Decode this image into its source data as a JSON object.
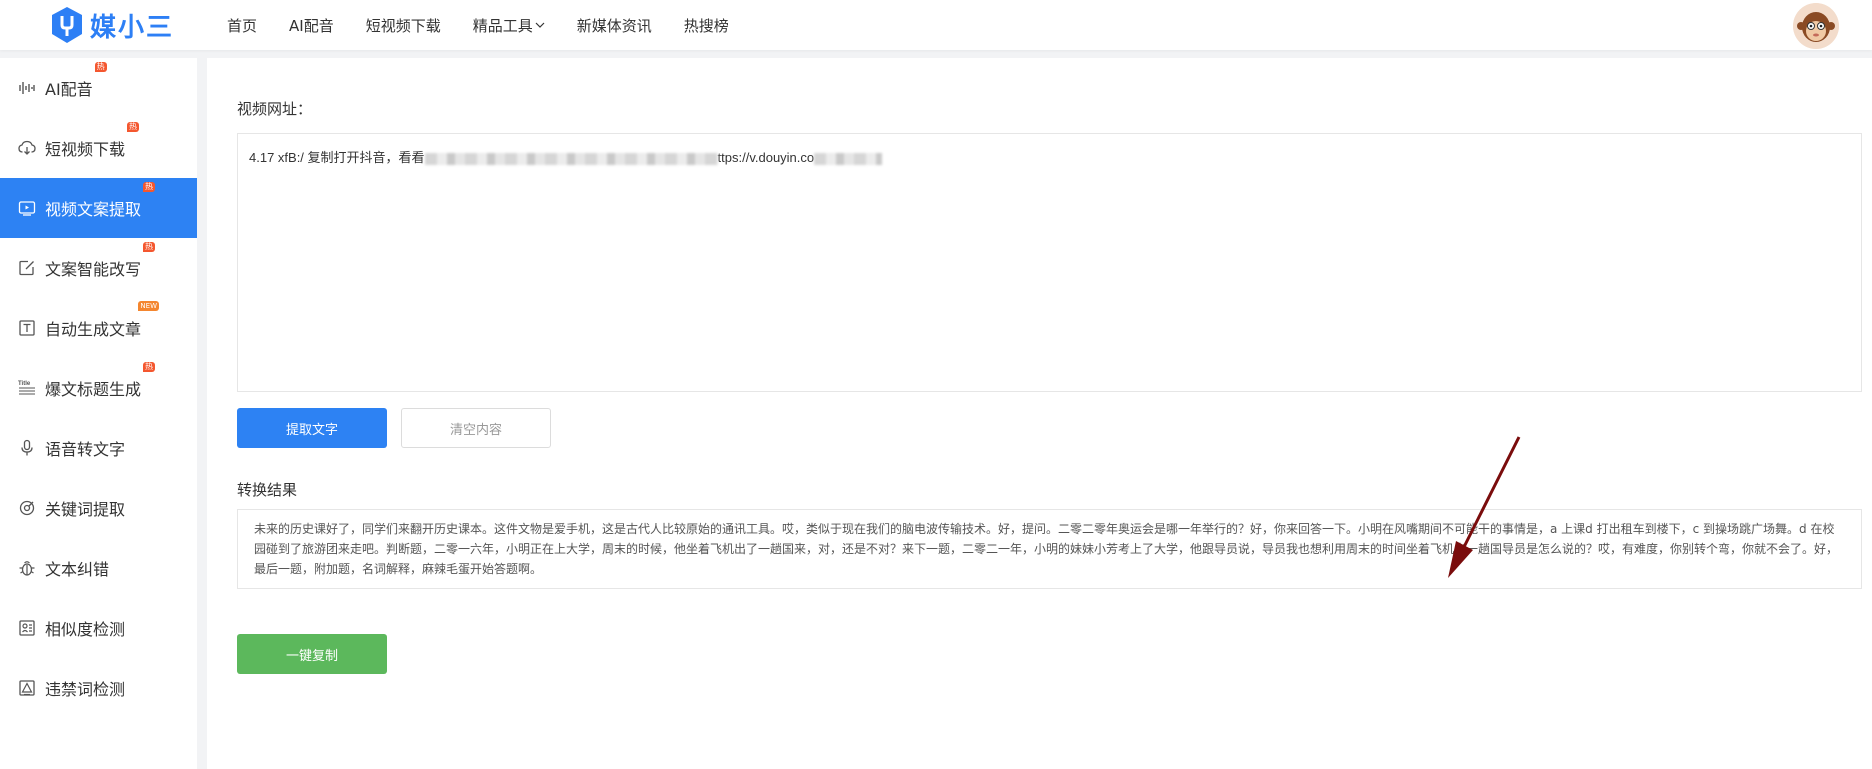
{
  "brand": {
    "name": "媒小三",
    "color": "#2d7ff5"
  },
  "top_nav": {
    "items": [
      {
        "label": "首页"
      },
      {
        "label": "AI配音"
      },
      {
        "label": "短视频下载"
      },
      {
        "label": "精品工具",
        "has_dropdown": true
      },
      {
        "label": "新媒体资讯"
      },
      {
        "label": "热搜榜"
      }
    ]
  },
  "sidebar": {
    "items": [
      {
        "label": "AI配音",
        "icon": "waveform-icon",
        "badge": "热"
      },
      {
        "label": "短视频下载",
        "icon": "cloud-download-icon",
        "badge": "热"
      },
      {
        "label": "视频文案提取",
        "icon": "video-icon",
        "badge": "热",
        "active": true
      },
      {
        "label": "文案智能改写",
        "icon": "edit-icon",
        "badge": "热"
      },
      {
        "label": "自动生成文章",
        "icon": "text-box-icon",
        "badge": "NEW"
      },
      {
        "label": "爆文标题生成",
        "icon": "title-icon",
        "badge": "热"
      },
      {
        "label": "语音转文字",
        "icon": "microphone-icon"
      },
      {
        "label": "关键词提取",
        "icon": "keyword-icon"
      },
      {
        "label": "文本纠错",
        "icon": "bug-icon"
      },
      {
        "label": "相似度检测",
        "icon": "similarity-icon"
      },
      {
        "label": "违禁词检测",
        "icon": "warning-box-icon"
      }
    ]
  },
  "main": {
    "url_label": "视频网址：",
    "url_value_start": "4.17 xfB:/ 复制打开抖音，看看",
    "url_value_mid": "ttps://v.douyin.co",
    "extract_button": "提取文字",
    "clear_button": "清空内容",
    "result_label": "转换结果",
    "result_text": "未来的历史课好了，同学们来翻开历史课本。这件文物是爱手机，这是古代人比较原始的通讯工具。哎，类似于现在我们的脑电波传输技术。好，提问。二零二零年奥运会是哪一年举行的？好，你来回答一下。小明在风嘴期间不可能干的事情是，a 上课d 打出租车到楼下，c 到操场跳广场舞。d 在校园碰到了旅游团来走吧。判断题，二零一六年，小明正在上大学，周末的时候，他坐着飞机出了一趟国来，对，还是不对？来下一题，二零二一年，小明的妹妹小芳考上了大学，他跟导员说，导员我也想利用周末的时间坐着飞机出一趟国导员是怎么说的？哎，有难度，你别转个弯，你就不会了。好，最后一题，附加题，名词解释，麻辣毛蛋开始答题啊。",
    "copy_button": "一键复制"
  },
  "colors": {
    "primary": "#2d82f3",
    "success": "#5cb85c",
    "hot_badge": "#f4572f",
    "arrow": "#7a0c0c"
  }
}
